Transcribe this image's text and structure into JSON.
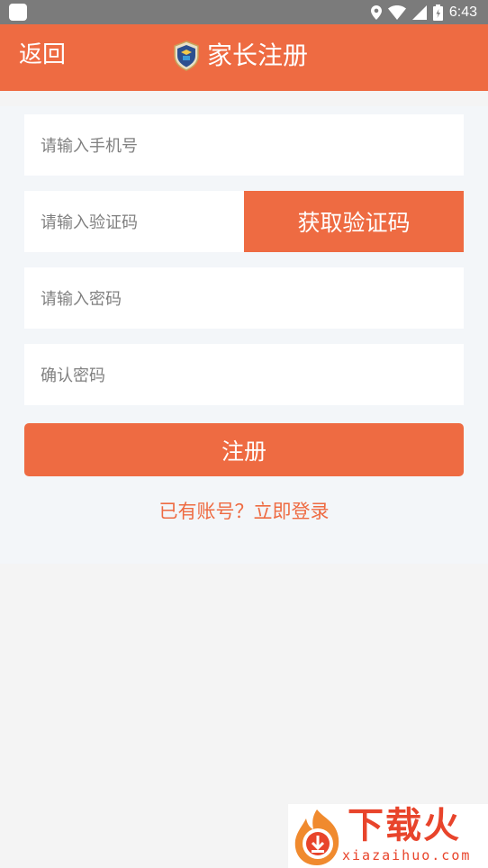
{
  "status_bar": {
    "time": "6:43"
  },
  "header": {
    "back_label": "返回",
    "title": "家长注册"
  },
  "form": {
    "phone_placeholder": "请输入手机号",
    "code_placeholder": "请输入验证码",
    "get_code_label": "获取验证码",
    "password_placeholder": "请输入密码",
    "confirm_placeholder": "确认密码",
    "register_label": "注册",
    "login_link": "已有账号？立即登录"
  },
  "watermark": {
    "text": "下载火",
    "sub": "xiazaihuo.com"
  },
  "colors": {
    "accent": "#ee6b42",
    "status_bar": "#7b7b7b",
    "background": "#f4f4f4"
  },
  "icons": [
    "app-icon",
    "location-icon",
    "wifi-icon",
    "signal-icon",
    "battery-icon",
    "school-badge-icon",
    "fire-logo-icon"
  ]
}
